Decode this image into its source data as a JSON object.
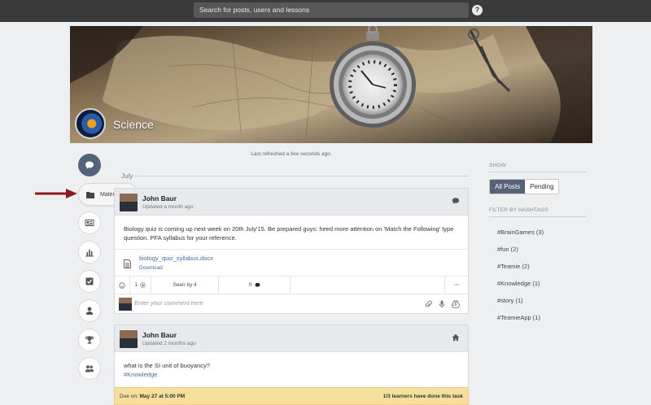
{
  "topbar": {
    "search_placeholder": "Search for posts, users and lessons",
    "help_glyph": "?"
  },
  "course": {
    "title": "Science",
    "last_refreshed": "Last refreshed a few seconds ago."
  },
  "sidebar": {
    "materials_label": "Materials",
    "items": [
      "chat-bubble-icon",
      "folder-icon",
      "newspaper-icon",
      "bar-chart-icon",
      "check-square-icon",
      "user-icon",
      "trophy-icon",
      "users-icon"
    ]
  },
  "feed": {
    "month": "July",
    "posts": [
      {
        "author": "John Baur",
        "time": "Updated a month ago",
        "body": "Biology quiz is coming up next week on 20th July'15. Be prepared guys: heed more attention on 'Match the Following' type question. PFA syllabus for your reference.",
        "attachment": "biology_quiz_syllabus.docx",
        "download_label": "Download",
        "likes": "1",
        "seen_by": "Seen by 4",
        "comments": "0",
        "more": "···",
        "comment_placeholder": "Enter your comment here"
      },
      {
        "author": "John Baur",
        "time": "Updated 2 months ago",
        "body": "what is the SI unit of buoyancy?",
        "hashtag": "#Knowledge"
      }
    ],
    "task": {
      "due_prefix": "Due on: ",
      "due_date": "May 27 at 5:00 PM",
      "progress": "1/3 learners have done this task"
    }
  },
  "right": {
    "show_title": "SHOW",
    "filter_all": "All Posts",
    "filter_pending": "Pending",
    "hashtags_title": "FILTER BY HASHTAGS",
    "hashtags": [
      "#BrainGames (3)",
      "#fun (2)",
      "#Teamie (2)",
      "#Knowledge (1)",
      "#story (1)",
      "#TeamieApp (1)"
    ]
  },
  "colors": {
    "accent": "#55637a",
    "arrow": "#8b1a1a",
    "due_bar": "#f6df9c",
    "link": "#4a6aa5"
  }
}
